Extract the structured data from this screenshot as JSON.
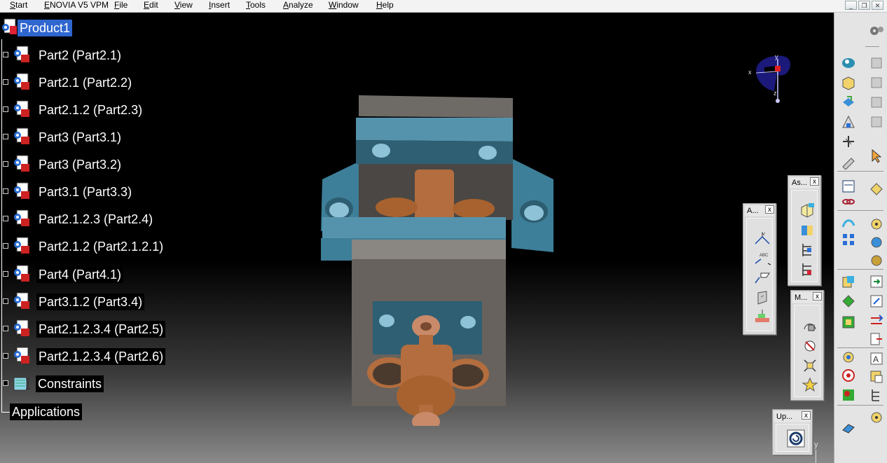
{
  "menubar": {
    "items": [
      "Start",
      "ENOVIA V5 VPM",
      "File",
      "Edit",
      "View",
      "Insert",
      "Tools",
      "Analyze",
      "Window",
      "Help"
    ]
  },
  "window_controls": {
    "minimize": "_",
    "restore": "❐",
    "close": "✕"
  },
  "tree": {
    "root": "Product1",
    "parts": [
      "Part2 (Part2.1)",
      "Part2.1 (Part2.2)",
      "Part2.1.2 (Part2.3)",
      "Part3 (Part3.1)",
      "Part3 (Part3.2)",
      "Part3.1 (Part3.3)",
      "Part2.1.2.3 (Part2.4)",
      "Part2.1.2 (Part2.1.2.1)",
      "Part4 (Part4.1)",
      "Part3.1.2 (Part3.4)",
      "Part2.1.2.3.4 (Part2.5)",
      "Part2.1.2.3.4 (Part2.6)"
    ],
    "constraints": "Constraints",
    "applications": "Applications"
  },
  "compass": {
    "x": "x",
    "y": "y",
    "z": "z"
  },
  "toolbars": {
    "annotation": {
      "title": "A...",
      "close": "x"
    },
    "assembly": {
      "title": "As...",
      "close": "x"
    },
    "move": {
      "title": "M...",
      "close": "x"
    },
    "update": {
      "title": "Up...",
      "close": "x"
    }
  },
  "axis_corner": {
    "y": "y"
  },
  "icons": {
    "tree_part": "part-icon",
    "tree_product": "product-icon",
    "tree_constraints": "constraints-icon"
  },
  "colors": {
    "selection": "#2f66cf",
    "part_blue": "#4d8fab",
    "part_gray": "#67625d",
    "part_copper": "#b36d3e",
    "compass": "#1b1a7a"
  }
}
